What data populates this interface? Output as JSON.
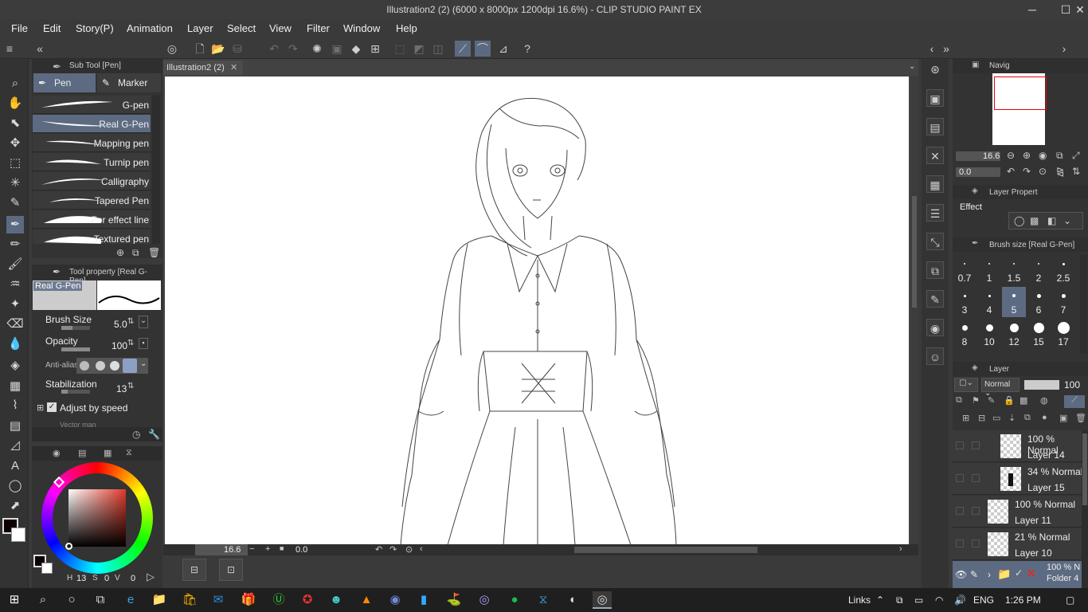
{
  "window": {
    "title": "Illustration2 (2) (6000 x 8000px 1200dpi 16.6%)  - CLIP STUDIO PAINT EX",
    "controls": [
      "─",
      "☐",
      "✕"
    ]
  },
  "menu": [
    "File",
    "Edit",
    "Story(P)",
    "Animation",
    "Layer",
    "Select",
    "View",
    "Filter",
    "Window",
    "Help"
  ],
  "subtool_panel": {
    "title": "Sub Tool [Pen]",
    "tabs": [
      "Pen",
      "Marker"
    ],
    "brushes": [
      "G-pen",
      "Real G-Pen",
      "Mapping pen",
      "Turnip pen",
      "Calligraphy",
      "Tapered Pen",
      "For effect line",
      "Textured pen"
    ],
    "selected_index": 1
  },
  "tool_property": {
    "title": "Tool property [Real G-Pen]",
    "preview_label": "Real G-Pen",
    "brush_size_label": "Brush Size",
    "brush_size_value": "5.0",
    "opacity_label": "Opacity",
    "opacity_value": "100",
    "antialias_label": "Anti-alias",
    "stabilization_label": "Stabilization",
    "stabilization_value": "13",
    "adjust_label": "Adjust by speed",
    "adjust_checked": true,
    "cut_text": "Vector man"
  },
  "color_panel": {
    "r_text": "13",
    "g_text": "0",
    "b_text": "0",
    "main_color": "#0d0000",
    "sub_color": "#ffffff"
  },
  "document": {
    "tab_label": "Illustration2 (2)",
    "zoom": "16.6",
    "rotation": "0.0"
  },
  "navigator": {
    "title": "Navig",
    "zoom": "16.6",
    "rotation": "0.0"
  },
  "layer_property": {
    "title": "Layer Propert",
    "effect_label": "Effect"
  },
  "brush_size_panel": {
    "title": "Brush size [Real G-Pen]",
    "sizes": [
      "0.7",
      "1",
      "1.5",
      "2",
      "2.5",
      "3",
      "4",
      "5",
      "6",
      "7",
      "8",
      "10",
      "12",
      "15",
      "17"
    ],
    "selected": "5"
  },
  "layer_panel": {
    "title": "Layer",
    "blend_mode": "Normal",
    "opacity": "100",
    "layers": [
      {
        "mode": "100 % Normal",
        "name": "Layer 14"
      },
      {
        "mode": "34 % Normal",
        "name": "Layer 15"
      },
      {
        "mode": "100 % Normal",
        "name": "Layer 11"
      },
      {
        "mode": "21 % Normal",
        "name": "Layer 10"
      },
      {
        "mode": "100 % N",
        "name": "Folder 4"
      }
    ]
  },
  "taskbar": {
    "links_label": "Links",
    "language": "ENG",
    "time": "1:26 PM"
  }
}
